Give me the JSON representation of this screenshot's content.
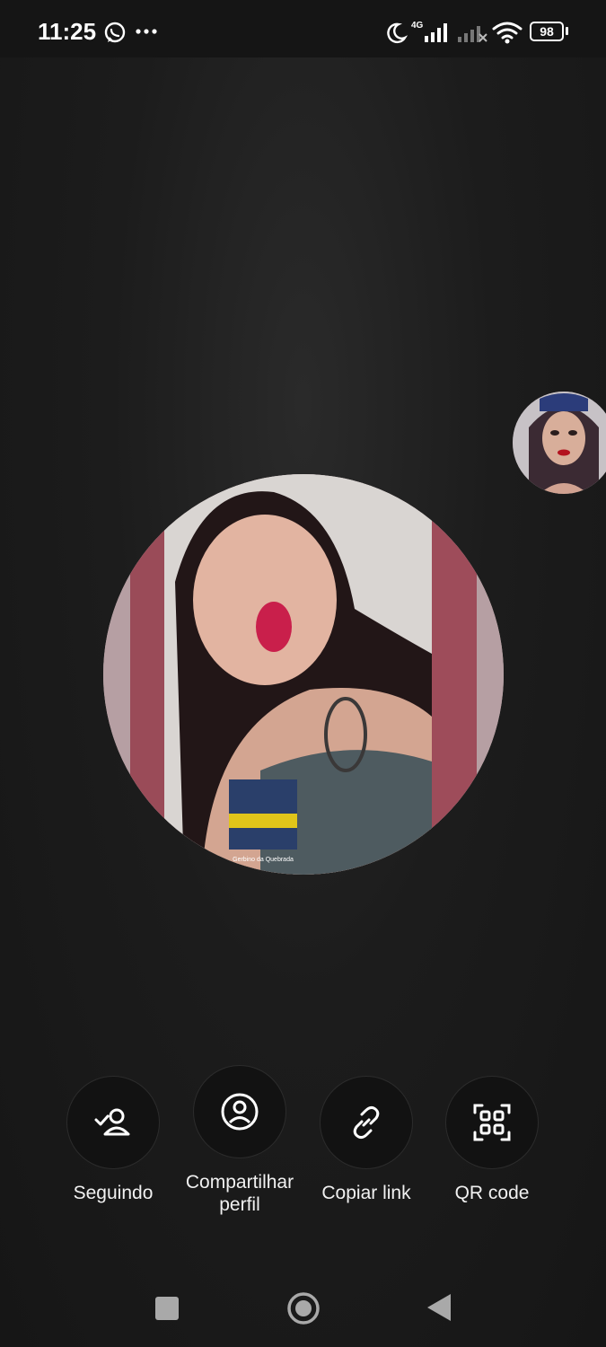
{
  "status_bar": {
    "time": "11:25",
    "battery": "98",
    "icons": [
      "whatsapp-icon",
      "more-icon",
      "moon-icon",
      "signal-4g-icon",
      "signal-no-service-icon",
      "wifi-icon",
      "battery-icon"
    ]
  },
  "profile": {
    "main_avatar": "profile-photo",
    "secondary_avatar": "account-photo"
  },
  "actions": [
    {
      "label": "Seguindo",
      "icon": "person-check-icon"
    },
    {
      "label": "Compartilhar perfil",
      "icon": "profile-share-icon"
    },
    {
      "label": "Copiar link",
      "icon": "link-icon"
    },
    {
      "label": "QR code",
      "icon": "qr-code-icon"
    }
  ],
  "navigation": {
    "buttons": [
      "recents-button",
      "home-button",
      "back-button"
    ]
  },
  "colors": {
    "background": "#1b1b1b",
    "button_bg": "#121212",
    "text": "#ffffff"
  }
}
